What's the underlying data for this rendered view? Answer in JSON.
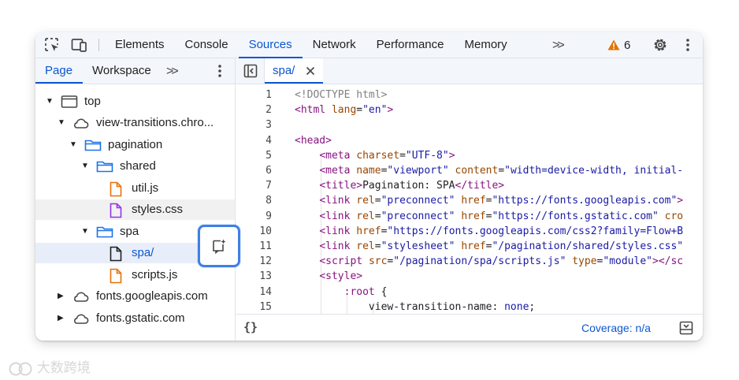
{
  "toolbar": {
    "tabs": [
      {
        "label": "Elements"
      },
      {
        "label": "Console"
      },
      {
        "label": "Sources"
      },
      {
        "label": "Network"
      },
      {
        "label": "Performance"
      },
      {
        "label": "Memory"
      }
    ],
    "active_tab": "Sources",
    "more_tabs": ">>",
    "warning_count": "6"
  },
  "navigator": {
    "tabs": [
      {
        "label": "Page"
      },
      {
        "label": "Workspace"
      }
    ],
    "more_tabs": ">>",
    "tree": [
      {
        "label": "top",
        "kind": "frame",
        "expanded": true
      },
      {
        "label": "view-transitions.chro...",
        "kind": "cloud",
        "expanded": true
      },
      {
        "label": "pagination",
        "kind": "folder",
        "expanded": true
      },
      {
        "label": "shared",
        "kind": "folder",
        "expanded": true
      },
      {
        "label": "util.js",
        "kind": "file-js"
      },
      {
        "label": "styles.css",
        "kind": "file-css"
      },
      {
        "label": "spa",
        "kind": "folder",
        "expanded": true
      },
      {
        "label": "spa/",
        "kind": "file-doc",
        "selected": true
      },
      {
        "label": "scripts.js",
        "kind": "file-js"
      },
      {
        "label": "fonts.googleapis.com",
        "kind": "cloud",
        "expanded": false
      },
      {
        "label": "fonts.gstatic.com",
        "kind": "cloud",
        "expanded": false
      }
    ]
  },
  "editor": {
    "file_tab": "spa/",
    "line_numbers": [
      "1",
      "2",
      "3",
      "4",
      "5",
      "6",
      "7",
      "8",
      "9",
      "10",
      "11",
      "12",
      "13",
      "14",
      "15"
    ],
    "lines": [
      [
        {
          "t": "c",
          "s": "<!DOCTYPE html>"
        }
      ],
      [
        {
          "t": "t",
          "s": "<html "
        },
        {
          "t": "a",
          "s": "lang"
        },
        {
          "t": "p",
          "s": "="
        },
        {
          "t": "v",
          "s": "\"en\""
        },
        {
          "t": "t",
          "s": ">"
        }
      ],
      [],
      [
        {
          "t": "t",
          "s": "<head>"
        }
      ],
      [
        {
          "t": "p",
          "s": "    "
        },
        {
          "t": "t",
          "s": "<meta "
        },
        {
          "t": "a",
          "s": "charset"
        },
        {
          "t": "p",
          "s": "="
        },
        {
          "t": "v",
          "s": "\"UTF-8\""
        },
        {
          "t": "t",
          "s": ">"
        }
      ],
      [
        {
          "t": "p",
          "s": "    "
        },
        {
          "t": "t",
          "s": "<meta "
        },
        {
          "t": "a",
          "s": "name"
        },
        {
          "t": "p",
          "s": "="
        },
        {
          "t": "v",
          "s": "\"viewport\""
        },
        {
          "t": "p",
          "s": " "
        },
        {
          "t": "a",
          "s": "content"
        },
        {
          "t": "p",
          "s": "="
        },
        {
          "t": "v",
          "s": "\"width=device-width, initial-"
        }
      ],
      [
        {
          "t": "p",
          "s": "    "
        },
        {
          "t": "t",
          "s": "<title>"
        },
        {
          "t": "p",
          "s": "Pagination: SPA"
        },
        {
          "t": "t",
          "s": "</title>"
        }
      ],
      [
        {
          "t": "p",
          "s": "    "
        },
        {
          "t": "t",
          "s": "<link "
        },
        {
          "t": "a",
          "s": "rel"
        },
        {
          "t": "p",
          "s": "="
        },
        {
          "t": "v",
          "s": "\"preconnect\""
        },
        {
          "t": "p",
          "s": " "
        },
        {
          "t": "a",
          "s": "href"
        },
        {
          "t": "p",
          "s": "="
        },
        {
          "t": "v",
          "s": "\"https://fonts.googleapis.com\""
        },
        {
          "t": "t",
          "s": ">"
        }
      ],
      [
        {
          "t": "p",
          "s": "    "
        },
        {
          "t": "t",
          "s": "<link "
        },
        {
          "t": "a",
          "s": "rel"
        },
        {
          "t": "p",
          "s": "="
        },
        {
          "t": "v",
          "s": "\"preconnect\""
        },
        {
          "t": "p",
          "s": " "
        },
        {
          "t": "a",
          "s": "href"
        },
        {
          "t": "p",
          "s": "="
        },
        {
          "t": "v",
          "s": "\"https://fonts.gstatic.com\""
        },
        {
          "t": "p",
          "s": " "
        },
        {
          "t": "a",
          "s": "cro"
        }
      ],
      [
        {
          "t": "p",
          "s": "    "
        },
        {
          "t": "t",
          "s": "<link "
        },
        {
          "t": "a",
          "s": "href"
        },
        {
          "t": "p",
          "s": "="
        },
        {
          "t": "v",
          "s": "\"https://fonts.googleapis.com/css2?family=Flow+B"
        }
      ],
      [
        {
          "t": "p",
          "s": "    "
        },
        {
          "t": "t",
          "s": "<link "
        },
        {
          "t": "a",
          "s": "rel"
        },
        {
          "t": "p",
          "s": "="
        },
        {
          "t": "v",
          "s": "\"stylesheet\""
        },
        {
          "t": "p",
          "s": " "
        },
        {
          "t": "a",
          "s": "href"
        },
        {
          "t": "p",
          "s": "="
        },
        {
          "t": "v",
          "s": "\"/pagination/shared/styles.css\""
        }
      ],
      [
        {
          "t": "p",
          "s": "    "
        },
        {
          "t": "t",
          "s": "<script "
        },
        {
          "t": "a",
          "s": "src"
        },
        {
          "t": "p",
          "s": "="
        },
        {
          "t": "v",
          "s": "\"/pagination/spa/scripts.js\""
        },
        {
          "t": "p",
          "s": " "
        },
        {
          "t": "a",
          "s": "type"
        },
        {
          "t": "p",
          "s": "="
        },
        {
          "t": "v",
          "s": "\"module\""
        },
        {
          "t": "t",
          "s": "></sc"
        }
      ],
      [
        {
          "t": "p",
          "s": "    "
        },
        {
          "t": "t",
          "s": "<style>"
        }
      ],
      [
        {
          "t": "p",
          "s": "        "
        },
        {
          "t": "t",
          "s": ":root"
        },
        {
          "t": "p",
          "s": " {"
        }
      ],
      [
        {
          "t": "p",
          "s": "            view-transition-name: "
        },
        {
          "t": "v",
          "s": "none"
        },
        {
          "t": "p",
          "s": ";"
        }
      ]
    ]
  },
  "status": {
    "format_label": "{}",
    "coverage": "Coverage: n/a"
  },
  "watermark": "大数跨境",
  "colors": {
    "accent": "#0b57d0",
    "tag": "#881280",
    "attr": "#994500",
    "value": "#1a1aa6",
    "warning": "#e37400",
    "css_icon": "#9334e6",
    "js_icon": "#e8710a"
  }
}
